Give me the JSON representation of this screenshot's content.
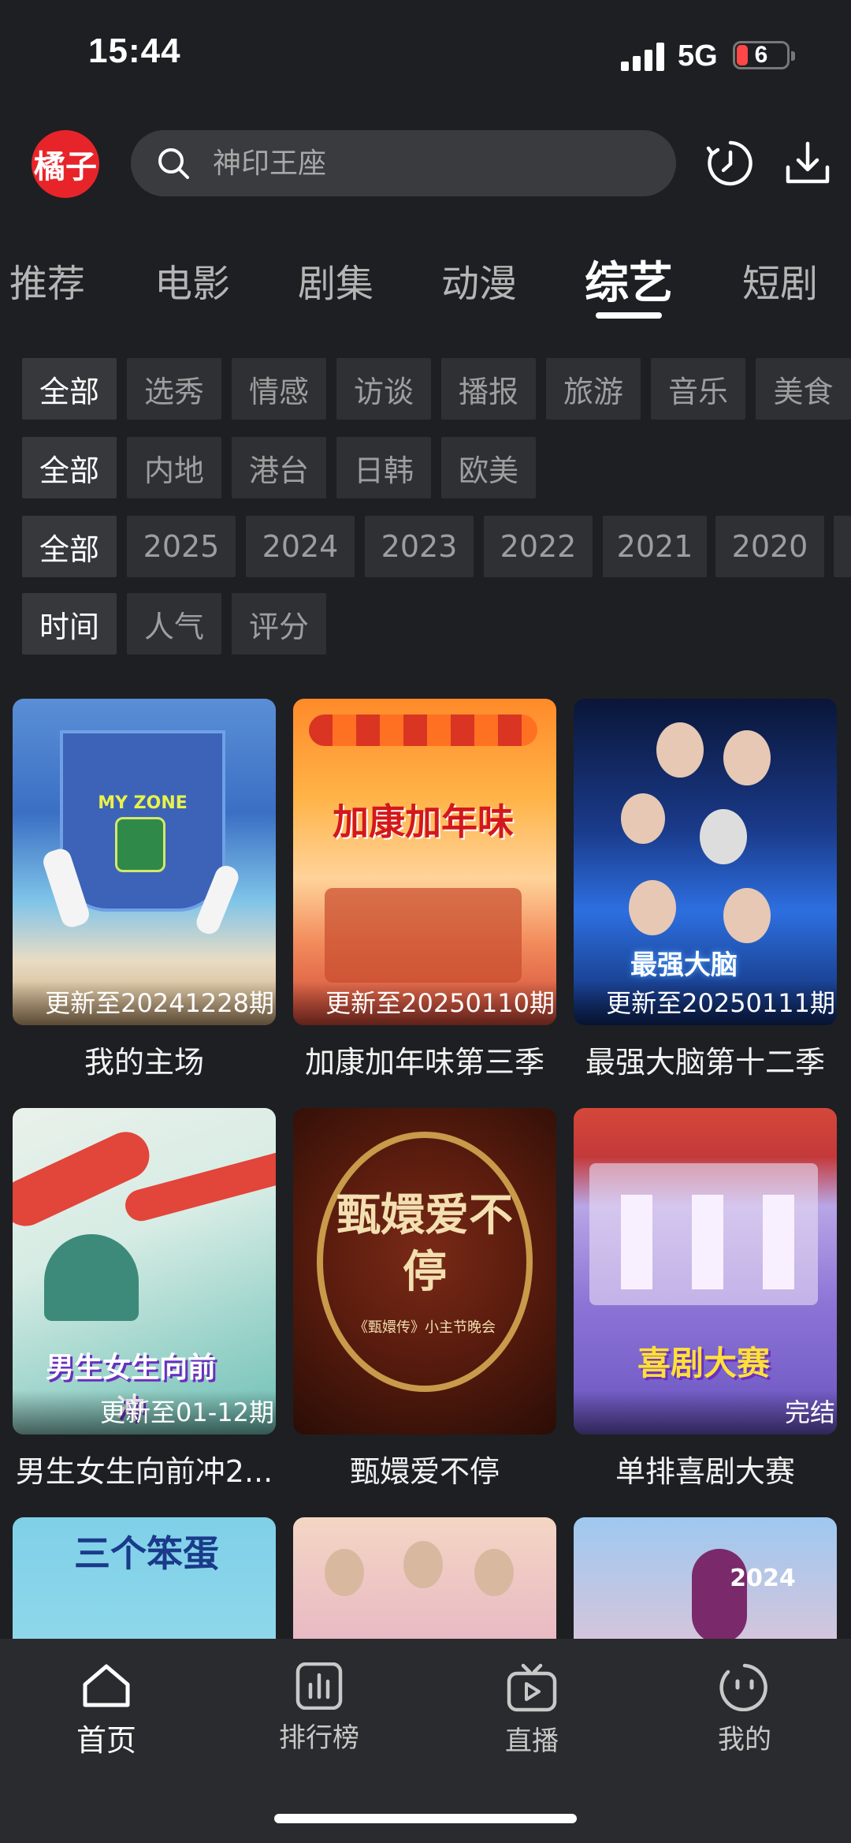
{
  "status_bar": {
    "time": "15:44",
    "network": "5G",
    "battery": "6"
  },
  "header": {
    "logo_text": "橘子",
    "search_placeholder": "神印王座"
  },
  "tabs": [
    {
      "label": "推荐"
    },
    {
      "label": "电影"
    },
    {
      "label": "剧集"
    },
    {
      "label": "动漫"
    },
    {
      "label": "综艺",
      "active": true
    },
    {
      "label": "短剧"
    }
  ],
  "filters": {
    "genre": [
      "全部",
      "选秀",
      "情感",
      "访谈",
      "播报",
      "旅游",
      "音乐",
      "美食"
    ],
    "region": [
      "全部",
      "内地",
      "港台",
      "日韩",
      "欧美"
    ],
    "year": [
      "全部",
      "2025",
      "2024",
      "2023",
      "2022",
      "2021",
      "2020"
    ],
    "sort": [
      "时间",
      "人气",
      "评分"
    ]
  },
  "cards": [
    {
      "title": "我的主场",
      "badge": "更新至20241228期",
      "art": "MY ZONE"
    },
    {
      "title": "加康加年味第三季",
      "badge": "更新至20250110期",
      "art": "加康加年味"
    },
    {
      "title": "最强大脑第十二季",
      "badge": "更新至20250111期",
      "art": "最强大脑"
    },
    {
      "title": "男生女生向前冲2...",
      "badge": "更新至01-12期",
      "art": "男生女生向前冲"
    },
    {
      "title": "甄嬛爱不停",
      "badge": "",
      "art": "甄嬛爱不停",
      "art_sub": "《甄嬛传》小主节晚会"
    },
    {
      "title": "单排喜剧大赛",
      "badge": "完结",
      "art": "喜剧大赛"
    },
    {
      "title": "",
      "badge": "",
      "art": "三个笨蛋"
    },
    {
      "title": "",
      "badge": "",
      "art": ""
    },
    {
      "title": "",
      "badge": "",
      "art": "2024"
    }
  ],
  "bottom_nav": [
    {
      "label": "首页",
      "icon": "home-icon",
      "active": true
    },
    {
      "label": "排行榜",
      "icon": "ranking-icon"
    },
    {
      "label": "直播",
      "icon": "live-tv-icon"
    },
    {
      "label": "我的",
      "icon": "profile-face-icon"
    }
  ]
}
